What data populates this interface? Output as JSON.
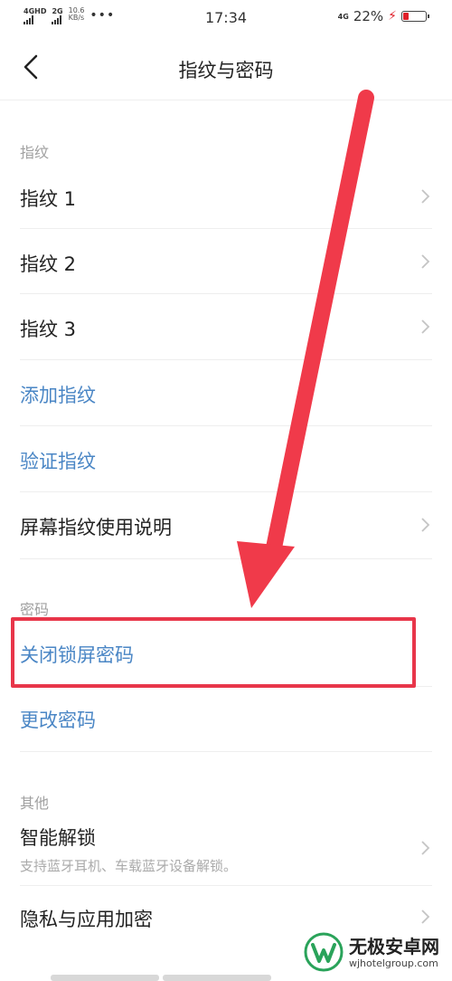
{
  "status_bar": {
    "network1": "4GHD",
    "network2": "2G",
    "speed_value": "10.6",
    "speed_unit": "KB/s",
    "more": "•••",
    "time": "17:34",
    "network_right": "4G",
    "battery_percent": "22%",
    "battery_level": 0.22,
    "battery_color": "#e0202a"
  },
  "header": {
    "title": "指纹与密码",
    "back_icon": "chevron-left-icon"
  },
  "sections": {
    "fingerprint": "指纹",
    "password": "密码",
    "other": "其他"
  },
  "rows": {
    "fingerprint1": "指纹 1",
    "fingerprint2": "指纹 2",
    "fingerprint3": "指纹 3",
    "add_fingerprint": "添加指纹",
    "verify_fingerprint": "验证指纹",
    "screen_fingerprint_guide": "屏幕指纹使用说明",
    "close_lock_password": "关闭锁屏密码",
    "change_password": "更改密码",
    "smart_unlock": "智能解锁",
    "smart_unlock_desc": "支持蓝牙耳机、车载蓝牙设备解锁。",
    "privacy_app_encrypt": "隐私与应用加密"
  },
  "colors": {
    "link_blue": "#4a86c5",
    "annotation_red": "#e8364a"
  },
  "watermark": {
    "name": "无极安卓网",
    "url": "wjhotelgroup.com"
  }
}
